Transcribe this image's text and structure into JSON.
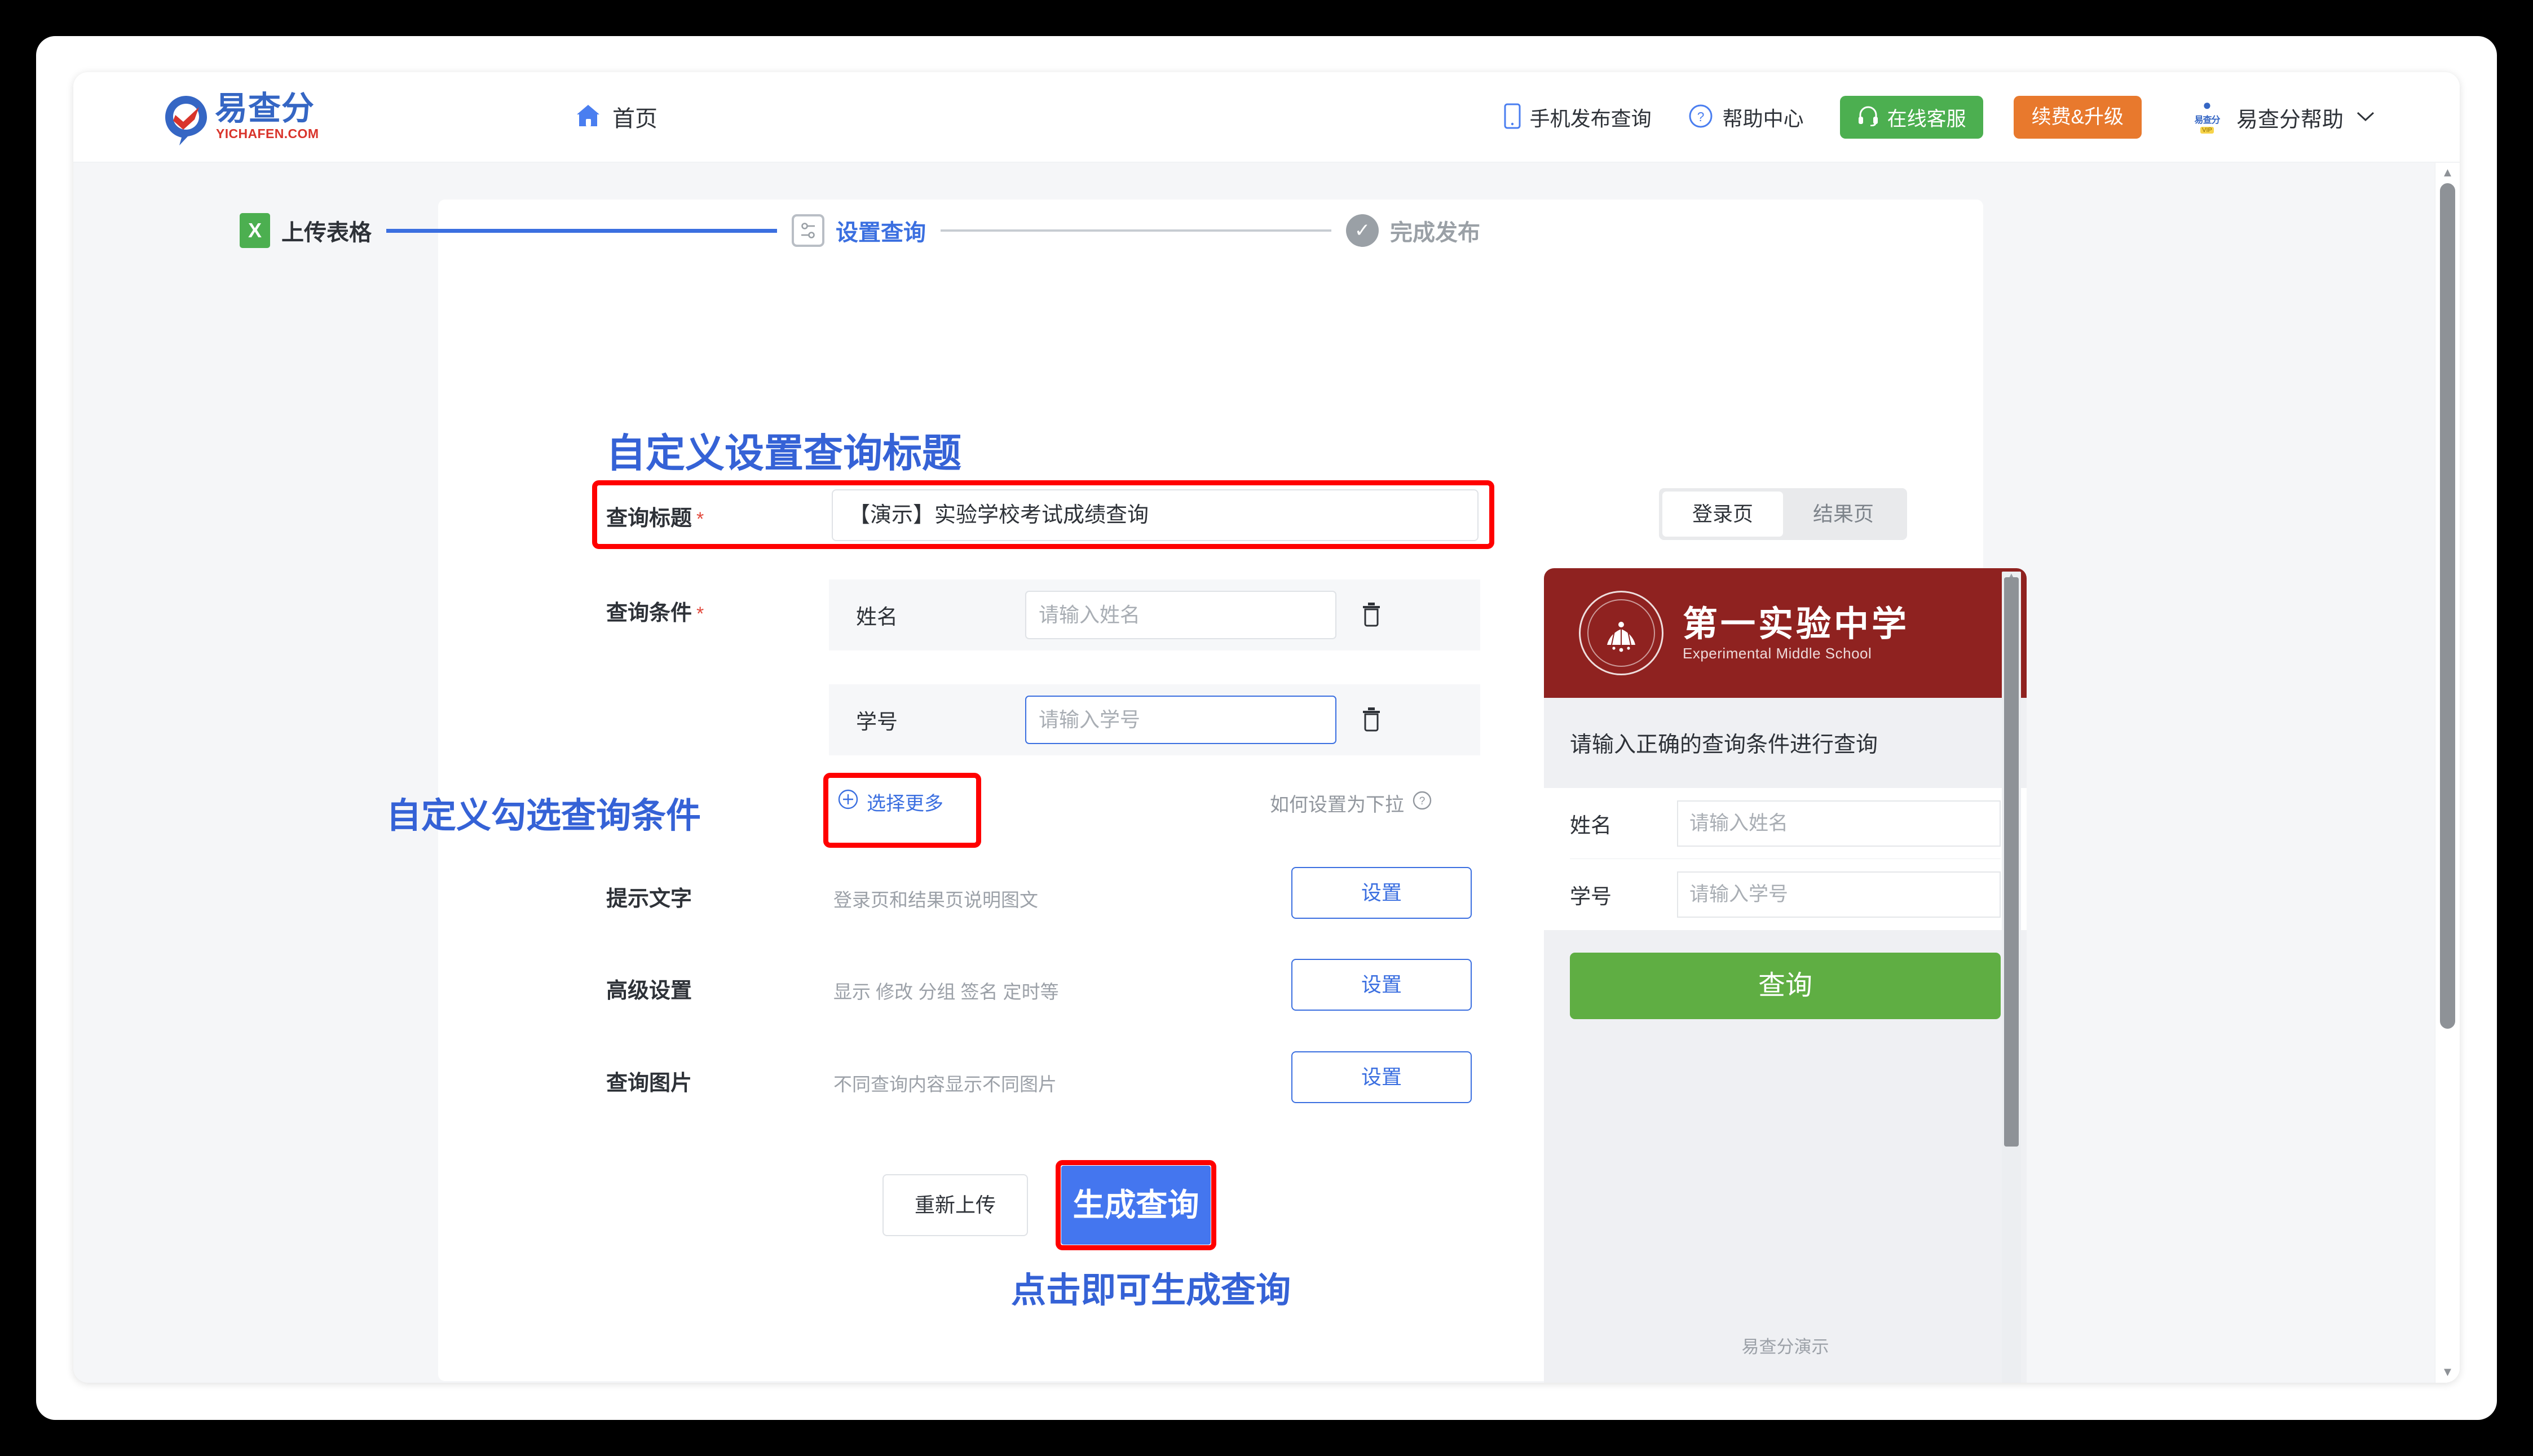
{
  "nav": {
    "logo_text": "易查分",
    "logo_sub": "YICHAFEN.COM",
    "home_label": "首页",
    "mobile_publish_label": "手机发布查询",
    "help_center_label": "帮助中心",
    "online_service_label": "在线客服",
    "upgrade_label": "续费&升级",
    "user_name": "易查分帮助",
    "avatar_word": "易查分",
    "avatar_tag": "VIP",
    "colors": {
      "service_green": "#4caf50",
      "upgrade_orange": "#e8792d",
      "brand_blue": "#3566c4",
      "brand_red": "#d9342b"
    }
  },
  "stepper": {
    "steps": [
      {
        "label": "上传表格",
        "state": "done",
        "icon": "excel-icon"
      },
      {
        "label": "设置查询",
        "state": "active",
        "icon": "settings-icon"
      },
      {
        "label": "完成发布",
        "state": "todo",
        "icon": "check-circle-icon"
      }
    ]
  },
  "annotations": {
    "title": "自定义设置查询标题",
    "conditions": "自定义勾选查询条件",
    "click_generate": "点击即可生成查询",
    "color": "#3562d6",
    "highlight_color": "#ff0000"
  },
  "form": {
    "title_label": "查询标题",
    "title_required": "*",
    "title_value": "【演示】实验学校考试成绩查询",
    "conditions_label": "查询条件",
    "conditions_required": "*",
    "conditions": [
      {
        "name": "姓名",
        "placeholder": "请输入姓名",
        "focused": false,
        "delete_icon": "trash-icon"
      },
      {
        "name": "学号",
        "placeholder": "请输入学号",
        "focused": true,
        "delete_icon": "trash-icon"
      }
    ],
    "select_more_label": "选择更多",
    "dropdown_hint_label": "如何设置为下拉",
    "settings_rows": [
      {
        "label": "提示文字",
        "desc": "登录页和结果页说明图文",
        "button": "设置"
      },
      {
        "label": "高级设置",
        "desc": "显示 修改 分组 签名 定时等",
        "button": "设置"
      },
      {
        "label": "查询图片",
        "desc": "不同查询内容显示不同图片",
        "button": "设置"
      }
    ],
    "reupload_label": "重新上传",
    "generate_label": "生成查询"
  },
  "preview": {
    "tabs": [
      {
        "label": "登录页",
        "active": true
      },
      {
        "label": "结果页",
        "active": false
      }
    ],
    "banner": {
      "school_cn": "第一实验中学",
      "school_en": "Experimental Middle School",
      "crest_text": "第一实验中学",
      "bg_color": "#8f2220"
    },
    "notice": "请输入正确的查询条件进行查询",
    "fields": [
      {
        "label": "姓名",
        "placeholder": "请输入姓名"
      },
      {
        "label": "学号",
        "placeholder": "请输入学号"
      }
    ],
    "query_button": "查询",
    "footer": "易查分演示",
    "query_button_color": "#5fae43"
  }
}
